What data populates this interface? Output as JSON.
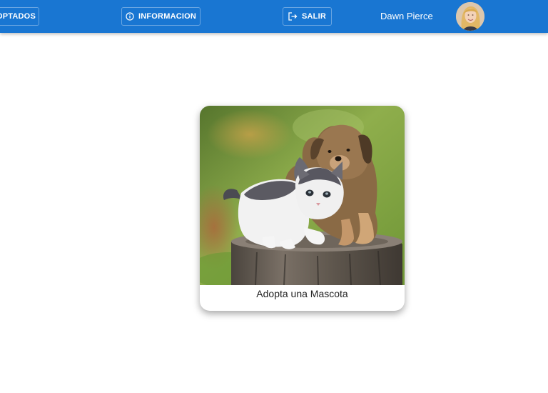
{
  "nav": {
    "adoptados_label": "OPTADOS",
    "informacion_label": "INFORMACION",
    "salir_label": "SALIR",
    "user_name": "Dawn Pierce"
  },
  "icons": {
    "info": "info-circle-icon",
    "logout": "logout-icon"
  },
  "colors": {
    "primary": "#1976d2",
    "text_on_primary": "#ffffff"
  },
  "card": {
    "title": "Adopta una Mascota"
  }
}
